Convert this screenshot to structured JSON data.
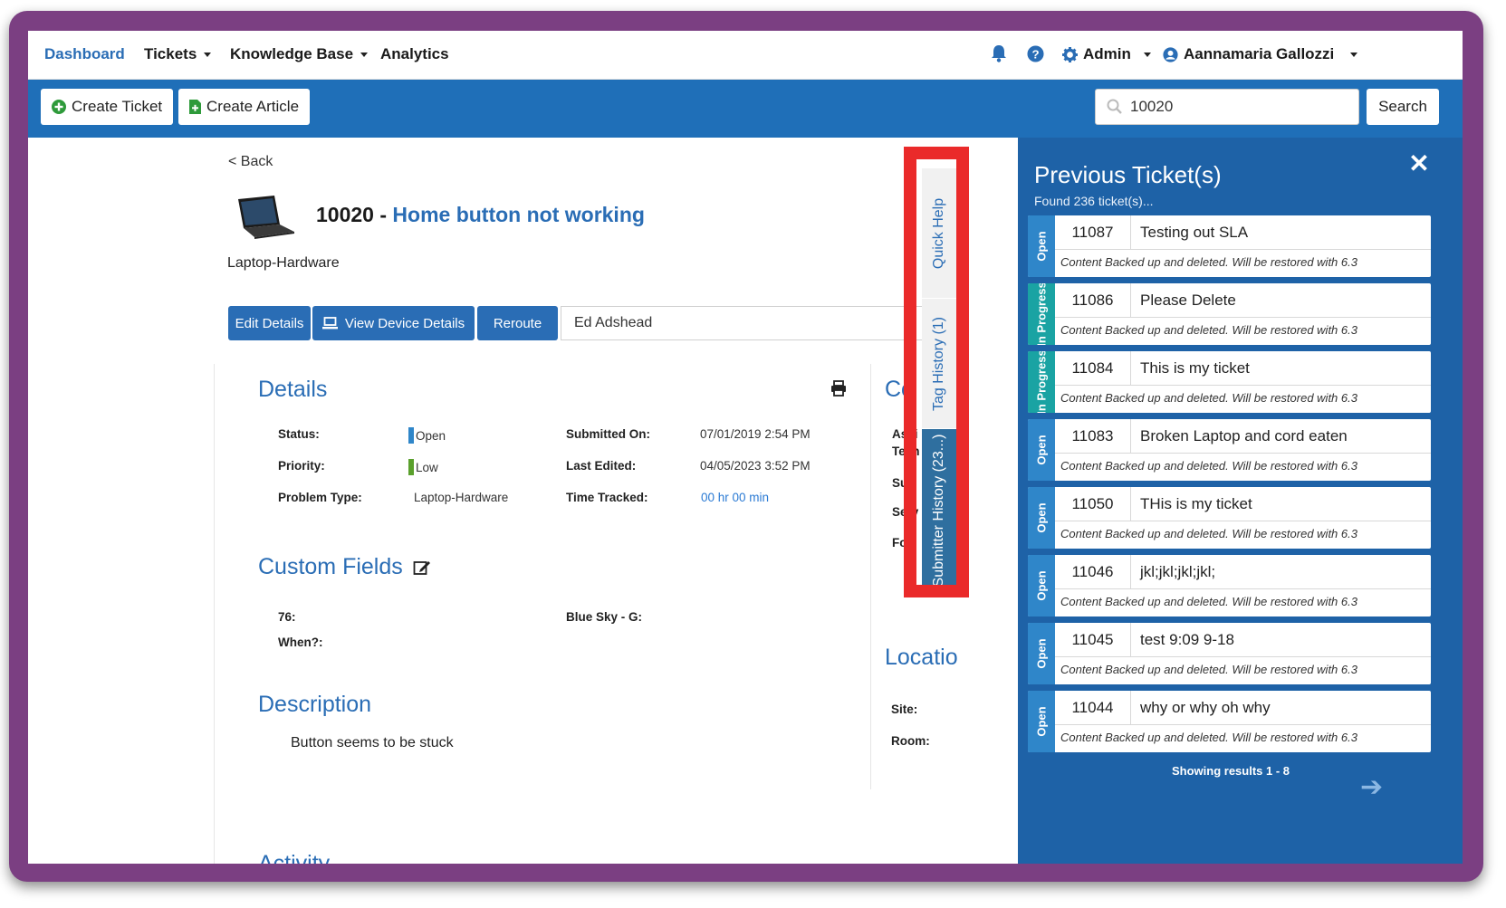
{
  "nav": {
    "dashboard": "Dashboard",
    "tickets": "Tickets",
    "knowledge_base": "Knowledge Base",
    "analytics": "Analytics",
    "admin": "Admin",
    "user": "Aannamaria Gallozzi"
  },
  "toolbar": {
    "create_ticket": "Create Ticket",
    "create_article": "Create Article",
    "search_value": "10020",
    "search_button": "Search"
  },
  "ticket": {
    "back": "< Back",
    "number": "10020 - ",
    "subject": "Home button not working",
    "problem_type_heading": "Laptop-Hardware",
    "buttons": {
      "edit": "Edit Details",
      "view_device": "View Device Details",
      "reroute": "Reroute"
    },
    "assignee": "Ed Adshead"
  },
  "details": {
    "heading": "Details",
    "status_label": "Status:",
    "status_value": "Open",
    "priority_label": "Priority:",
    "priority_value": "Low",
    "problem_type_label": "Problem Type:",
    "problem_type_value": "Laptop-Hardware",
    "submitted_label": "Submitted On:",
    "submitted_value": "07/01/2019 2:54 PM",
    "edited_label": "Last Edited:",
    "edited_value": "04/05/2023 3:52 PM",
    "time_label": "Time Tracked:",
    "time_value": "00 hr 00 min"
  },
  "custom_fields": {
    "heading": "Custom Fields",
    "field1": "76:",
    "field2": "When?:",
    "field3": "Blue Sky - G:"
  },
  "description": {
    "heading": "Description",
    "text": "Button seems to be stuck",
    "activity_heading": "Activity"
  },
  "partial_right": {
    "co_heading": "Co",
    "assigned_fragment": "Assi",
    "tech_fragment": "Tech",
    "sub_fragment": "Sub",
    "serv_fragment": "Serv",
    "foll_fragment": "Foll",
    "location_heading": "Locatio",
    "site_label": "Site:",
    "room_label": "Room:"
  },
  "vertical_tabs": {
    "quick_help": "Quick Help",
    "tag_history": "Tag History (1)",
    "submitter_history": "Submitter History (23...)"
  },
  "panel": {
    "title": "Previous Ticket(s)",
    "subtitle": "Found 236 ticket(s)...",
    "tickets": [
      {
        "id": "11087",
        "title": "Testing out SLA",
        "desc": "Content Backed up and deleted. Will be restored with 6.3",
        "status": "Open"
      },
      {
        "id": "11086",
        "title": "Please Delete",
        "desc": "Content Backed up and deleted. Will be restored with 6.3",
        "status": "In Progress"
      },
      {
        "id": "11084",
        "title": "This is my ticket",
        "desc": "Content Backed up and deleted. Will be restored with 6.3",
        "status": "In Progress"
      },
      {
        "id": "11083",
        "title": "Broken Laptop and cord eaten",
        "desc": "Content Backed up and deleted. Will be restored with 6.3",
        "status": "Open"
      },
      {
        "id": "11050",
        "title": "THis is my ticket",
        "desc": "Content Backed up and deleted. Will be restored with 6.3",
        "status": "Open"
      },
      {
        "id": "11046",
        "title": "jkl;jkl;jkl;jkl;",
        "desc": "Content Backed up and deleted. Will be restored with 6.3",
        "status": "Open"
      },
      {
        "id": "11045",
        "title": "test 9:09 9-18",
        "desc": "Content Backed up and deleted. Will be restored with 6.3",
        "status": "Open"
      },
      {
        "id": "11044",
        "title": "why or why oh why",
        "desc": "Content Backed up and deleted. Will be restored with 6.3",
        "status": "Open"
      }
    ],
    "showing": "Showing results 1 - 8"
  },
  "colors": {
    "primary": "#1f6fb8",
    "link_blue": "#2a6db5",
    "status_open": "#2f86c9",
    "status_in_progress": "#1aa3a3",
    "priority_low": "#5aa02c",
    "highlight": "#ea2a2a",
    "frame": "#7b3f82"
  }
}
